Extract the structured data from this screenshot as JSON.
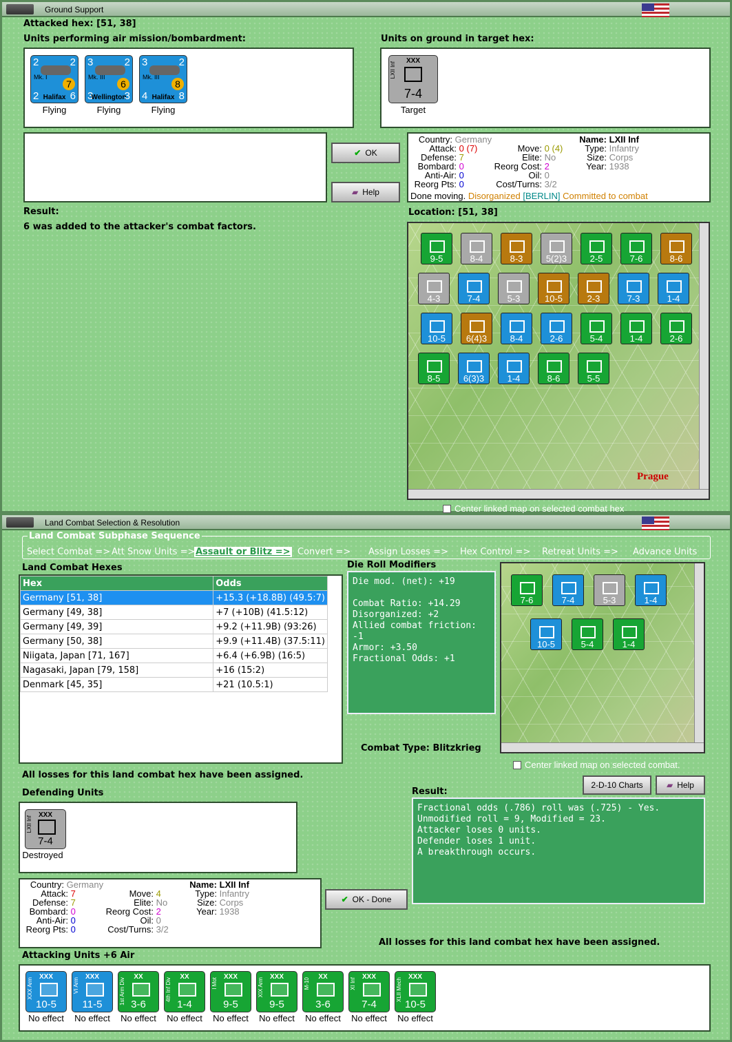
{
  "win1": {
    "title": "Ground Support",
    "attacked_hex": "Attacked hex:  [51, 38]",
    "air_label": "Units performing air mission/bombardment:",
    "ground_label": "Units on ground in target hex:",
    "air_units": [
      {
        "name": "Halifax",
        "top_left": "2",
        "top_right": "2",
        "bl": "2",
        "br": "6",
        "mark": "Mk. I",
        "badge": "7",
        "status": "Flying"
      },
      {
        "name": "Wellington",
        "top_left": "3",
        "top_right": "2",
        "bl": "3",
        "br": "3",
        "mark": "Mk. III",
        "badge": "6",
        "status": "Flying"
      },
      {
        "name": "Halifax",
        "top_left": "3",
        "top_right": "2",
        "bl": "4",
        "br": "8",
        "mark": "Mk. III",
        "badge": "8",
        "status": "Flying"
      }
    ],
    "target": {
      "name": "LXII Inf",
      "size": "XXX",
      "value": "7-4",
      "status": "Target"
    },
    "ok": "OK",
    "help": "Help",
    "result_label": "Result:",
    "result_text": "6 was added to the attacker's combat factors.",
    "location": "Location:  [51, 38]",
    "info": {
      "country_k": "Country:",
      "country": "Germany",
      "attack_k": "Attack:",
      "attack": "0",
      "attack_mod": "(7)",
      "defense_k": "Defense:",
      "defense": "7",
      "bombard_k": "Bombard:",
      "bombard": "0",
      "antiair_k": "Anti-Air:",
      "antiair": "0",
      "reorg_k": "Reorg Pts:",
      "reorg": "0",
      "move_k": "Move:",
      "move": "0",
      "move_mod": "(4)",
      "elite_k": "Elite:",
      "elite": "No",
      "reorgcost_k": "Reorg Cost:",
      "reorgcost": "2",
      "oil_k": "Oil:",
      "oil": "0",
      "cost_k": "Cost/Turns:",
      "cost": "3/2",
      "name_k": "Name:",
      "name": "LXII Inf",
      "type_k": "Type:",
      "type": "Infantry",
      "size_k": "Size:",
      "size": "Corps",
      "year_k": "Year:",
      "year": "1938",
      "done": "Done moving.",
      "disorg": "Disorganized",
      "berlin": "[BERLIN]",
      "committed": "Committed to combat"
    },
    "center_map": "Center linked map on selected combat hex"
  },
  "win2": {
    "title": "Land Combat Selection & Resolution",
    "seq_title": "Land Combat Subphase Sequence",
    "sequence": [
      "Select Combat =>",
      "Att Snow Units =>",
      "Assault or Blitz =>",
      "Convert =>",
      "Assign Losses =>",
      "Hex Control =>",
      "Retreat Units =>",
      "Advance Units"
    ],
    "hexes_label": "Land Combat Hexes",
    "table_headers": [
      "Hex",
      "Odds"
    ],
    "rows": [
      [
        "Germany [51, 38]",
        "+15.3 (+18.8B) (49.5:7)"
      ],
      [
        "Germany [49, 38]",
        "+7 (+10B) (41.5:12)"
      ],
      [
        "Germany [49, 39]",
        "+9.2 (+11.9B) (93:26)"
      ],
      [
        "Germany [50, 38]",
        "+9.9 (+11.4B) (37.5:11)"
      ],
      [
        "Niigata, Japan [71, 167]",
        "+6.4 (+6.9B) (16:5)"
      ],
      [
        "Nagasaki, Japan [79, 158]",
        "+16 (15:2)"
      ],
      [
        "Denmark [45, 35]",
        "+21 (10.5:1)"
      ]
    ],
    "drm_label": "Die Roll Modifiers",
    "drm": [
      "Die mod. (net): +19",
      "",
      "Combat Ratio: +14.29",
      "Disorganized: +2",
      "Allied combat friction: -1",
      "Armor: +3.50",
      "Fractional Odds: +1"
    ],
    "combat_type": "Combat Type:  Blitzkrieg",
    "center_map": "Center linked map on selected combat.",
    "losses_msg": "All losses for this land combat hex have been assigned.",
    "defending_label": "Defending Units",
    "defender": {
      "name": "LXII Inf",
      "size": "XXX",
      "value": "7-4",
      "status": "Destroyed"
    },
    "charts_btn": "2-D-10 Charts",
    "help_btn": "Help",
    "ok_btn": "OK - Done",
    "result_label": "Result:",
    "result": [
      "Fractional odds (.786) roll was (.725)  - Yes.",
      "Unmodified roll = 9, Modified = 23.",
      "Attacker loses 0 units.",
      "Defender loses 1 unit.",
      "A breakthrough occurs."
    ],
    "losses_msg2": "All losses for this land combat hex have been assigned.",
    "attacking_label": "Attacking Units +6 Air",
    "info": {
      "country_k": "Country:",
      "country": "Germany",
      "attack_k": "Attack:",
      "attack": "7",
      "defense_k": "Defense:",
      "defense": "7",
      "bombard_k": "Bombard:",
      "bombard": "0",
      "antiair_k": "Anti-Air:",
      "antiair": "0",
      "reorg_k": "Reorg Pts:",
      "reorg": "0",
      "move_k": "Move:",
      "move": "4",
      "elite_k": "Elite:",
      "elite": "No",
      "reorgcost_k": "Reorg Cost:",
      "reorgcost": "2",
      "oil_k": "Oil:",
      "oil": "0",
      "cost_k": "Cost/Turns:",
      "cost": "3/2",
      "name_k": "Name:",
      "name": "LXII Inf",
      "type_k": "Type:",
      "type": "Infantry",
      "size_k": "Size:",
      "size": "Corps",
      "year_k": "Year:",
      "year": "1938"
    },
    "attackers": [
      {
        "name": "XXX Arm",
        "size": "XXX",
        "value": "10-5",
        "color": "blue",
        "status": "No effect"
      },
      {
        "name": "VI Arm",
        "size": "XXX",
        "value": "11-5",
        "color": "blue",
        "status": "No effect"
      },
      {
        "name": "1st Arm Div",
        "size": "XX",
        "value": "3-6",
        "color": "green",
        "status": "No effect"
      },
      {
        "name": "4th Inf Div",
        "size": "XX",
        "value": "1-4",
        "color": "green",
        "status": "No effect"
      },
      {
        "name": "I Mot",
        "size": "XXX",
        "value": "9-5",
        "color": "green",
        "status": "No effect"
      },
      {
        "name": "XIX Arm",
        "size": "XXX",
        "value": "9-5",
        "color": "green",
        "status": "No effect"
      },
      {
        "name": "M-10",
        "size": "XX",
        "value": "3-6",
        "color": "green",
        "status": "No effect"
      },
      {
        "name": "XI Inf",
        "size": "XXX",
        "value": "7-4",
        "color": "green",
        "status": "No effect"
      },
      {
        "name": "XLII Mech",
        "size": "XXX",
        "value": "10-5",
        "color": "green",
        "status": "No effect"
      }
    ]
  },
  "map1_values": [
    "9-5",
    "8-4",
    "8-3",
    "5(2)3",
    "2-5",
    "7-6",
    "8-6",
    "4-3",
    "7-4",
    "5-3",
    "10-5",
    "2-3",
    "7-3",
    "1-4",
    "10-5",
    "6(4)3",
    "8-4",
    "2-6",
    "5-4",
    "1-4",
    "2-6",
    "8-5",
    "6(3)3",
    "1-4",
    "8-6",
    "5-5"
  ],
  "map1_labels": [
    "Prague"
  ],
  "map2_values": [
    "7-6",
    "7-4",
    "5-3",
    "1-4",
    "10-5",
    "5-4",
    "1-4"
  ]
}
